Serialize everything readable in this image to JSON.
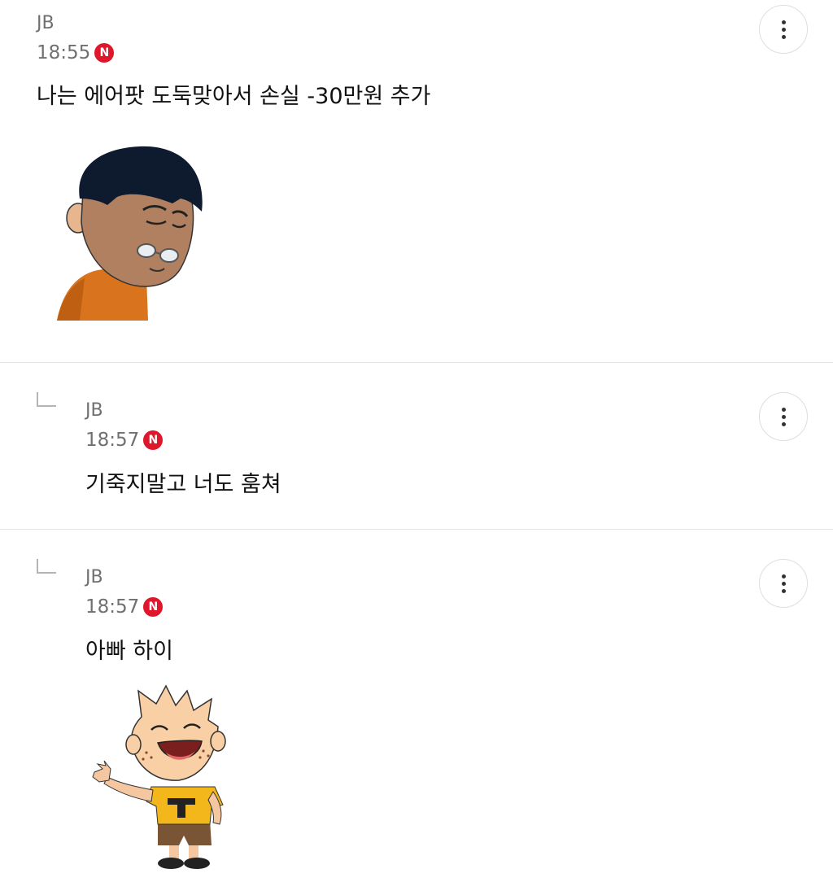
{
  "comments": [
    {
      "author": "JB",
      "time": "18:55",
      "new_badge": "N",
      "text": "나는 에어팟 도둑맞아서 손실 -30만원 추가",
      "sticker": "sad-old-man-sticker",
      "is_reply": false
    },
    {
      "author": "JB",
      "time": "18:57",
      "new_badge": "N",
      "text": "기죽지말고 너도 훔쳐",
      "is_reply": true
    },
    {
      "author": "JB",
      "time": "18:57",
      "new_badge": "N",
      "text": "아빠 하이",
      "sticker": "waving-boy-sticker",
      "is_reply": true
    }
  ],
  "icons": {
    "more": "more-vertical-icon",
    "reply": "reply-arrow-icon",
    "new": "new-badge-icon"
  },
  "colors": {
    "new_badge": "#e0162b",
    "meta_text": "#707070",
    "divider": "#e3e3e3"
  }
}
